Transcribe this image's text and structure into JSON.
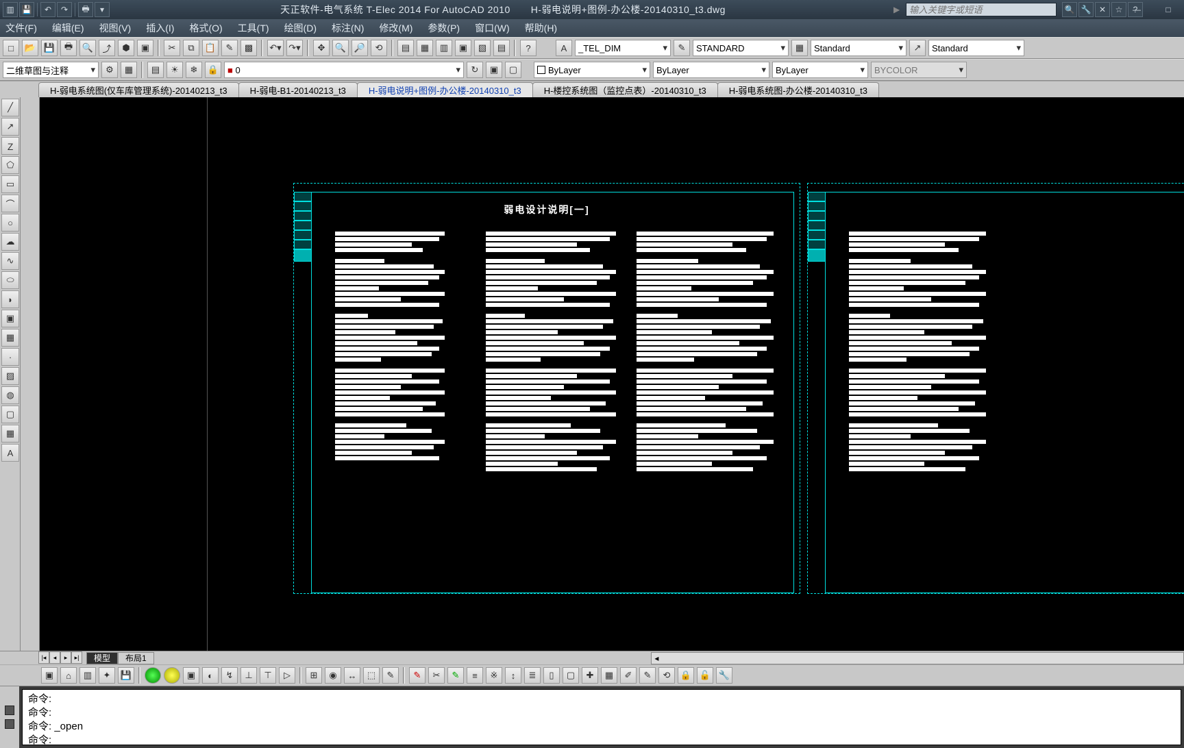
{
  "title": {
    "app": "天正软件-电气系统 T-Elec 2014  For AutoCAD 2010",
    "doc": "H-弱电说明+图例-办公楼-20140310_t3.dwg"
  },
  "search_placeholder": "输入关键字或短语",
  "menus": [
    "文件(F)",
    "编辑(E)",
    "视图(V)",
    "插入(I)",
    "格式(O)",
    "工具(T)",
    "绘图(D)",
    "标注(N)",
    "修改(M)",
    "参数(P)",
    "窗口(W)",
    "帮助(H)"
  ],
  "style_combos": {
    "dim": "_TEL_DIM",
    "text": "STANDARD",
    "table": "Standard",
    "mleader": "Standard"
  },
  "workspace": "二维草图与注释",
  "layer_current": "0",
  "props": {
    "color": "ByLayer",
    "linetype": "ByLayer",
    "lweight": "ByLayer",
    "plotstyle": "BYCOLOR"
  },
  "doc_tabs": [
    {
      "label": "H-弱电系统图(仅车库管理系统)-20140213_t3",
      "active": false
    },
    {
      "label": "H-弱电-B1-20140213_t3",
      "active": false
    },
    {
      "label": "H-弱电说明+图例-办公楼-20140310_t3",
      "active": true
    },
    {
      "label": "H-楼控系统图（监控点表）-20140310_t3",
      "active": false
    },
    {
      "label": "H-弱电系统图-办公楼-20140310_t3",
      "active": false
    }
  ],
  "drawing_heading": "弱电设计说明[一]",
  "layout_tabs": {
    "model": "模型",
    "layout1": "布局1"
  },
  "command_lines": [
    "命令:",
    "命令:",
    "命令: _open",
    "",
    "命令:"
  ]
}
